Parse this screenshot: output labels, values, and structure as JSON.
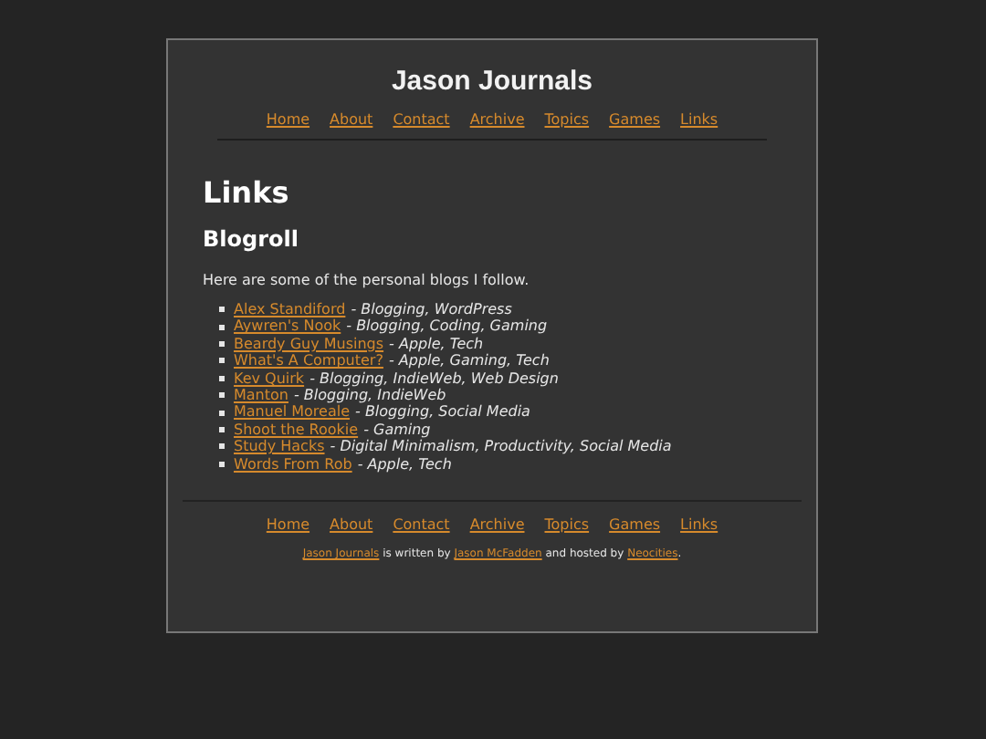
{
  "site_title": "Jason Journals",
  "nav": [
    "Home",
    "About",
    "Contact",
    "Archive",
    "Topics",
    "Games",
    "Links"
  ],
  "page_heading": "Links",
  "section_heading": "Blogroll",
  "intro": "Here are some of the personal blogs I follow.",
  "blogs": [
    {
      "name": "Alex Standiford",
      "tags": "- Blogging, WordPress"
    },
    {
      "name": "Aywren's Nook",
      "tags": "- Blogging, Coding, Gaming"
    },
    {
      "name": "Beardy Guy Musings",
      "tags": "- Apple, Tech"
    },
    {
      "name": "What's A Computer?",
      "tags": "- Apple, Gaming, Tech"
    },
    {
      "name": "Kev Quirk",
      "tags": "- Blogging, IndieWeb, Web Design"
    },
    {
      "name": "Manton",
      "tags": "- Blogging, IndieWeb"
    },
    {
      "name": "Manuel Moreale",
      "tags": "- Blogging, Social Media"
    },
    {
      "name": "Shoot the Rookie",
      "tags": "- Gaming"
    },
    {
      "name": "Study Hacks",
      "tags": "- Digital Minimalism, Productivity, Social Media"
    },
    {
      "name": "Words From Rob",
      "tags": "- Apple, Tech"
    }
  ],
  "footer_nav": [
    "Home",
    "About",
    "Contact",
    "Archive",
    "Topics",
    "Games",
    "Links"
  ],
  "credit": [
    {
      "kind": "link",
      "text": "Jason Journals"
    },
    {
      "kind": "text",
      "text": " is written by "
    },
    {
      "kind": "link",
      "text": "Jason McFadden"
    },
    {
      "kind": "text",
      "text": " and hosted by "
    },
    {
      "kind": "link",
      "text": "Neocities"
    },
    {
      "kind": "text",
      "text": "."
    }
  ]
}
